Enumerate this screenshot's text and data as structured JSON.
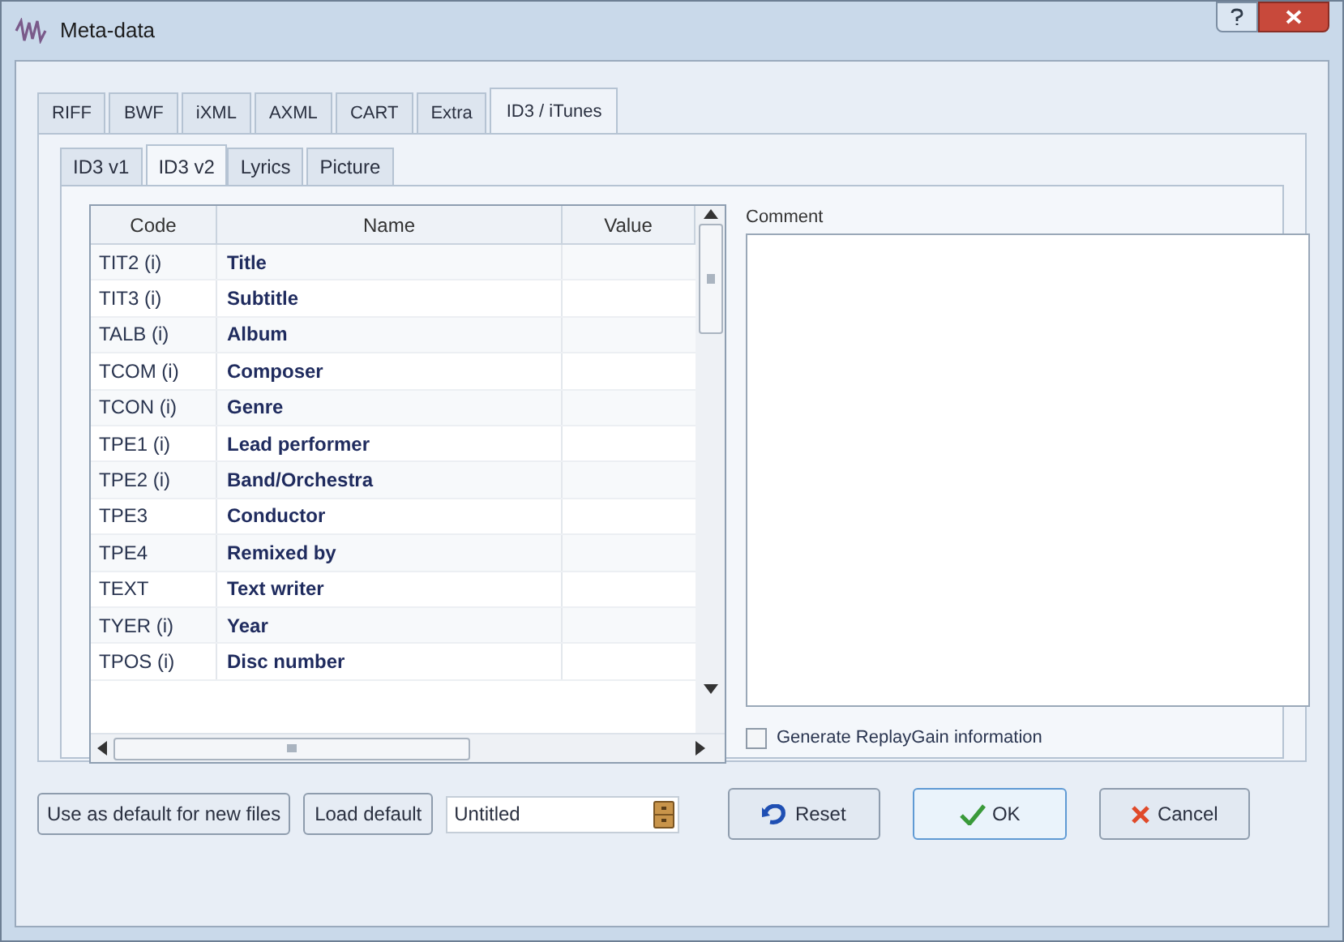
{
  "window": {
    "title": "Meta-data"
  },
  "tabs": [
    {
      "label": "RIFF",
      "selected": false
    },
    {
      "label": "BWF",
      "selected": false
    },
    {
      "label": "iXML",
      "selected": false
    },
    {
      "label": "AXML",
      "selected": false
    },
    {
      "label": "CART",
      "selected": false
    },
    {
      "label": "Extra",
      "selected": false
    },
    {
      "label": "ID3 / iTunes",
      "selected": true
    }
  ],
  "subtabs": [
    {
      "label": "ID3 v1",
      "selected": false
    },
    {
      "label": "ID3 v2",
      "selected": true
    },
    {
      "label": "Lyrics",
      "selected": false
    },
    {
      "label": "Picture",
      "selected": false
    }
  ],
  "table": {
    "columns": [
      "Code",
      "Name",
      "Value"
    ],
    "rows": [
      {
        "code": "TIT2 (i)",
        "name": "Title"
      },
      {
        "code": "TIT3 (i)",
        "name": "Subtitle"
      },
      {
        "code": "TALB (i)",
        "name": "Album"
      },
      {
        "code": "TCOM (i)",
        "name": "Composer"
      },
      {
        "code": "TCON (i)",
        "name": "Genre"
      },
      {
        "code": "TPE1 (i)",
        "name": "Lead performer"
      },
      {
        "code": "TPE2 (i)",
        "name": "Band/Orchestra"
      },
      {
        "code": "TPE3",
        "name": "Conductor"
      },
      {
        "code": "TPE4",
        "name": "Remixed by"
      },
      {
        "code": "TEXT",
        "name": "Text writer"
      },
      {
        "code": "TYER (i)",
        "name": "Year"
      },
      {
        "code": "TPOS (i)",
        "name": "Disc number"
      }
    ]
  },
  "comment": {
    "label": "Comment"
  },
  "replaygain": {
    "label": "Generate ReplayGain information",
    "checked": false
  },
  "footer": {
    "default_button": "Use as default for new files",
    "load_button": "Load default",
    "preset_field": "Untitled",
    "reset_button": "Reset",
    "ok_button": "OK",
    "cancel_button": "Cancel"
  }
}
